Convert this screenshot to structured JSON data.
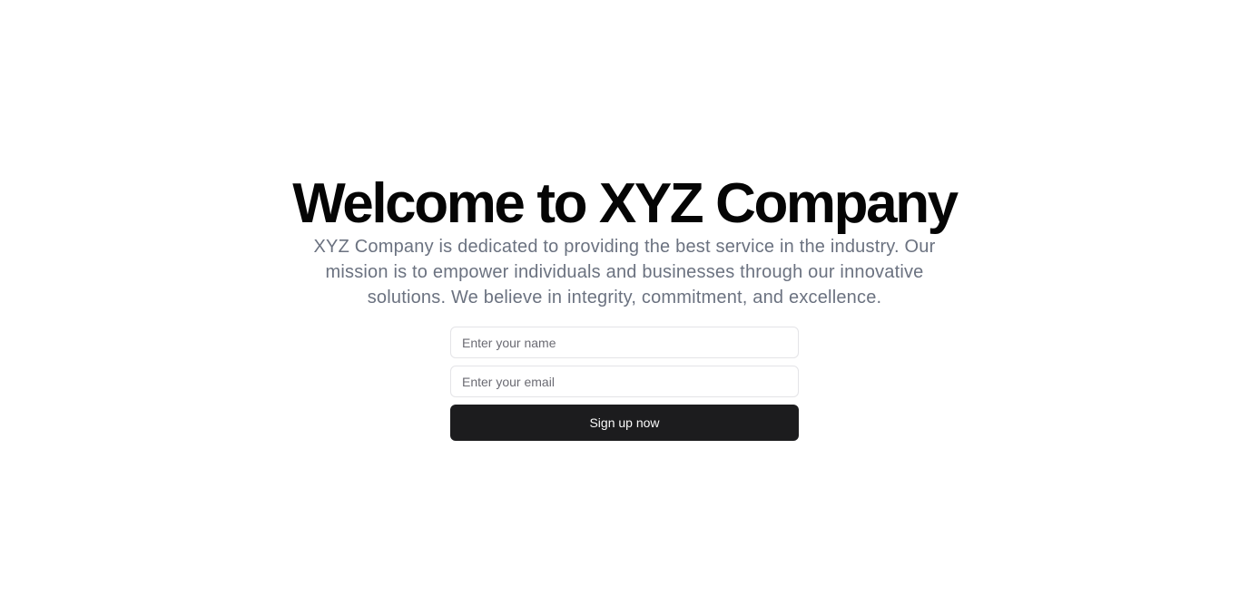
{
  "hero": {
    "title": "Welcome to XYZ Company",
    "description": "XYZ Company is dedicated to providing the best service in the industry. Our mission is to empower individuals and businesses through our innovative solutions. We believe in integrity, commitment, and excellence."
  },
  "form": {
    "name_placeholder": "Enter your name",
    "name_value": "",
    "email_placeholder": "Enter your email",
    "email_value": "",
    "submit_label": "Sign up now"
  },
  "colors": {
    "background": "#ffffff",
    "title": "#050505",
    "description": "#6b7280",
    "button": "#1c1c1e",
    "button_text": "#fafafa",
    "input_border": "#e4e4e7"
  }
}
